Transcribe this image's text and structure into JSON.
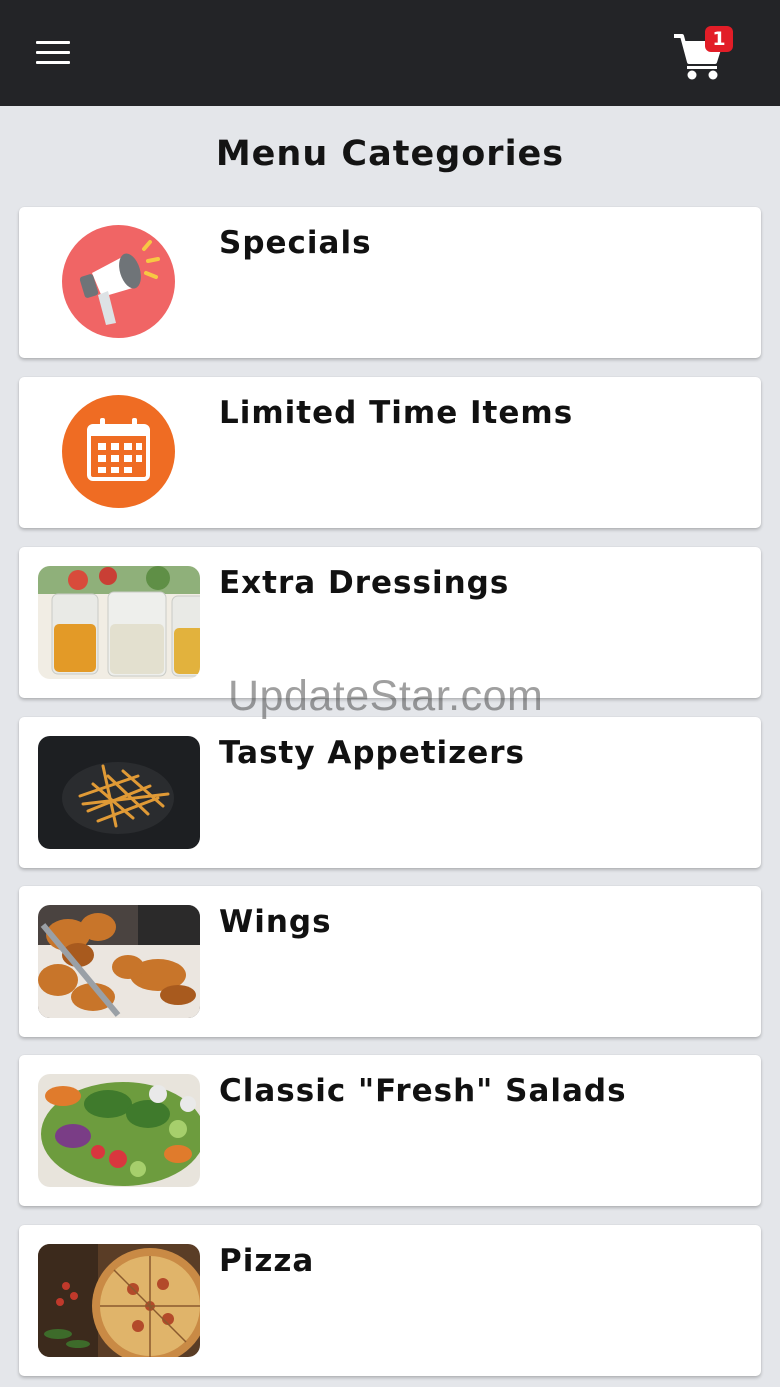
{
  "header": {
    "menu_icon": "hamburger-menu-icon",
    "cart_icon": "shopping-cart-icon",
    "cart_count": "1",
    "cart_badge_color": "#e21d27"
  },
  "page_title": "Menu Categories",
  "categories": [
    {
      "label": "Specials",
      "icon": "megaphone-icon",
      "icon_color": "#f06565"
    },
    {
      "label": "Limited Time Items",
      "icon": "calendar-icon",
      "icon_color": "#ef6c23"
    },
    {
      "label": "Extra Dressings",
      "image": "dressing-jars-photo"
    },
    {
      "label": "Tasty Appetizers",
      "image": "fries-photo"
    },
    {
      "label": "Wings",
      "image": "fried-wings-photo"
    },
    {
      "label": "Classic \"Fresh\" Salads",
      "image": "salad-photo"
    },
    {
      "label": "Pizza",
      "image": "pizza-photo"
    }
  ],
  "watermark": "UpdateStar.com"
}
